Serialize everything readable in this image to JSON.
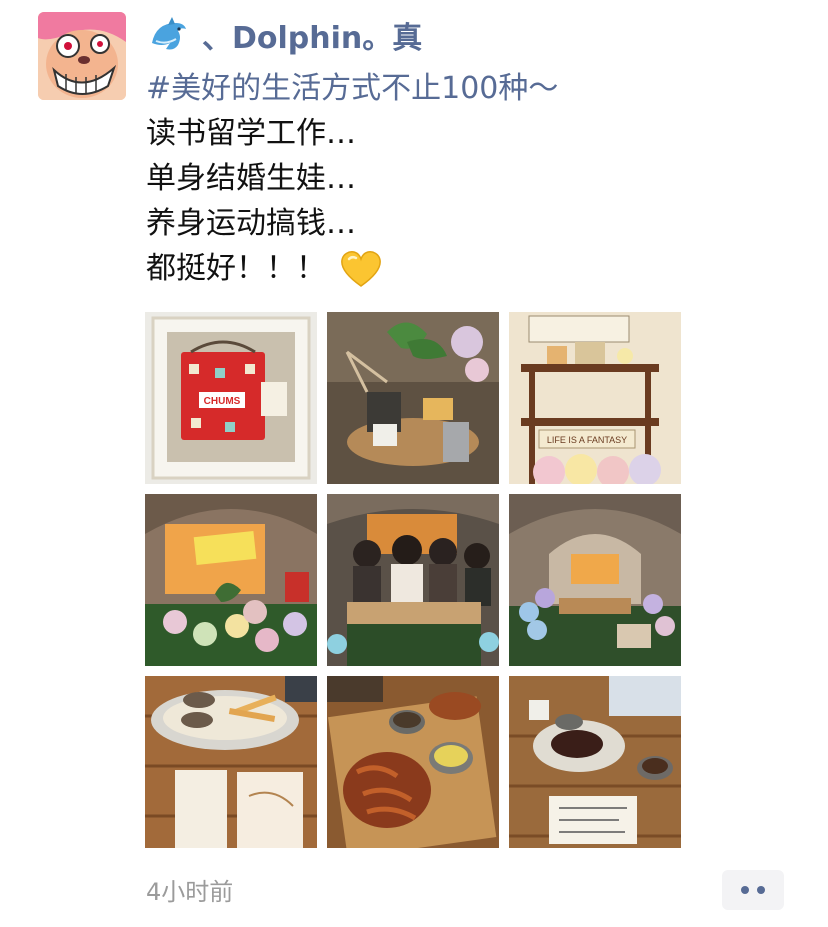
{
  "post": {
    "author": {
      "avatar_icon": "cartoon-avatar",
      "emoji_icon": "dolphin-icon",
      "name": "、Dolphin。真"
    },
    "text": {
      "hashtag": "#美好的生活方式不止100种～",
      "lines": [
        "读书留学工作…",
        "单身结婚生娃…",
        "养身运动搞钱…",
        "都挺好！！！"
      ],
      "trailing_emoji": "yellow-heart-icon"
    },
    "photos": [
      {
        "icon": "chums-bag-photo",
        "label": "CHUMS"
      },
      {
        "icon": "camp-coffee-table-photo"
      },
      {
        "icon": "shelf-decor-photo",
        "label": "LIFE IS A FANTASY"
      },
      {
        "icon": "tent-balloons-photo"
      },
      {
        "icon": "group-friends-photo"
      },
      {
        "icon": "tent-interior-photo"
      },
      {
        "icon": "fries-tray-photo"
      },
      {
        "icon": "grilled-wings-photo"
      },
      {
        "icon": "snack-plates-photo"
      }
    ],
    "timestamp": "4小时前",
    "more_icon": "ellipsis-icon"
  },
  "colors": {
    "link": "#576b95",
    "text": "#111111",
    "timestamp": "#9b9b9b",
    "more_bg": "#f3f3f5"
  }
}
